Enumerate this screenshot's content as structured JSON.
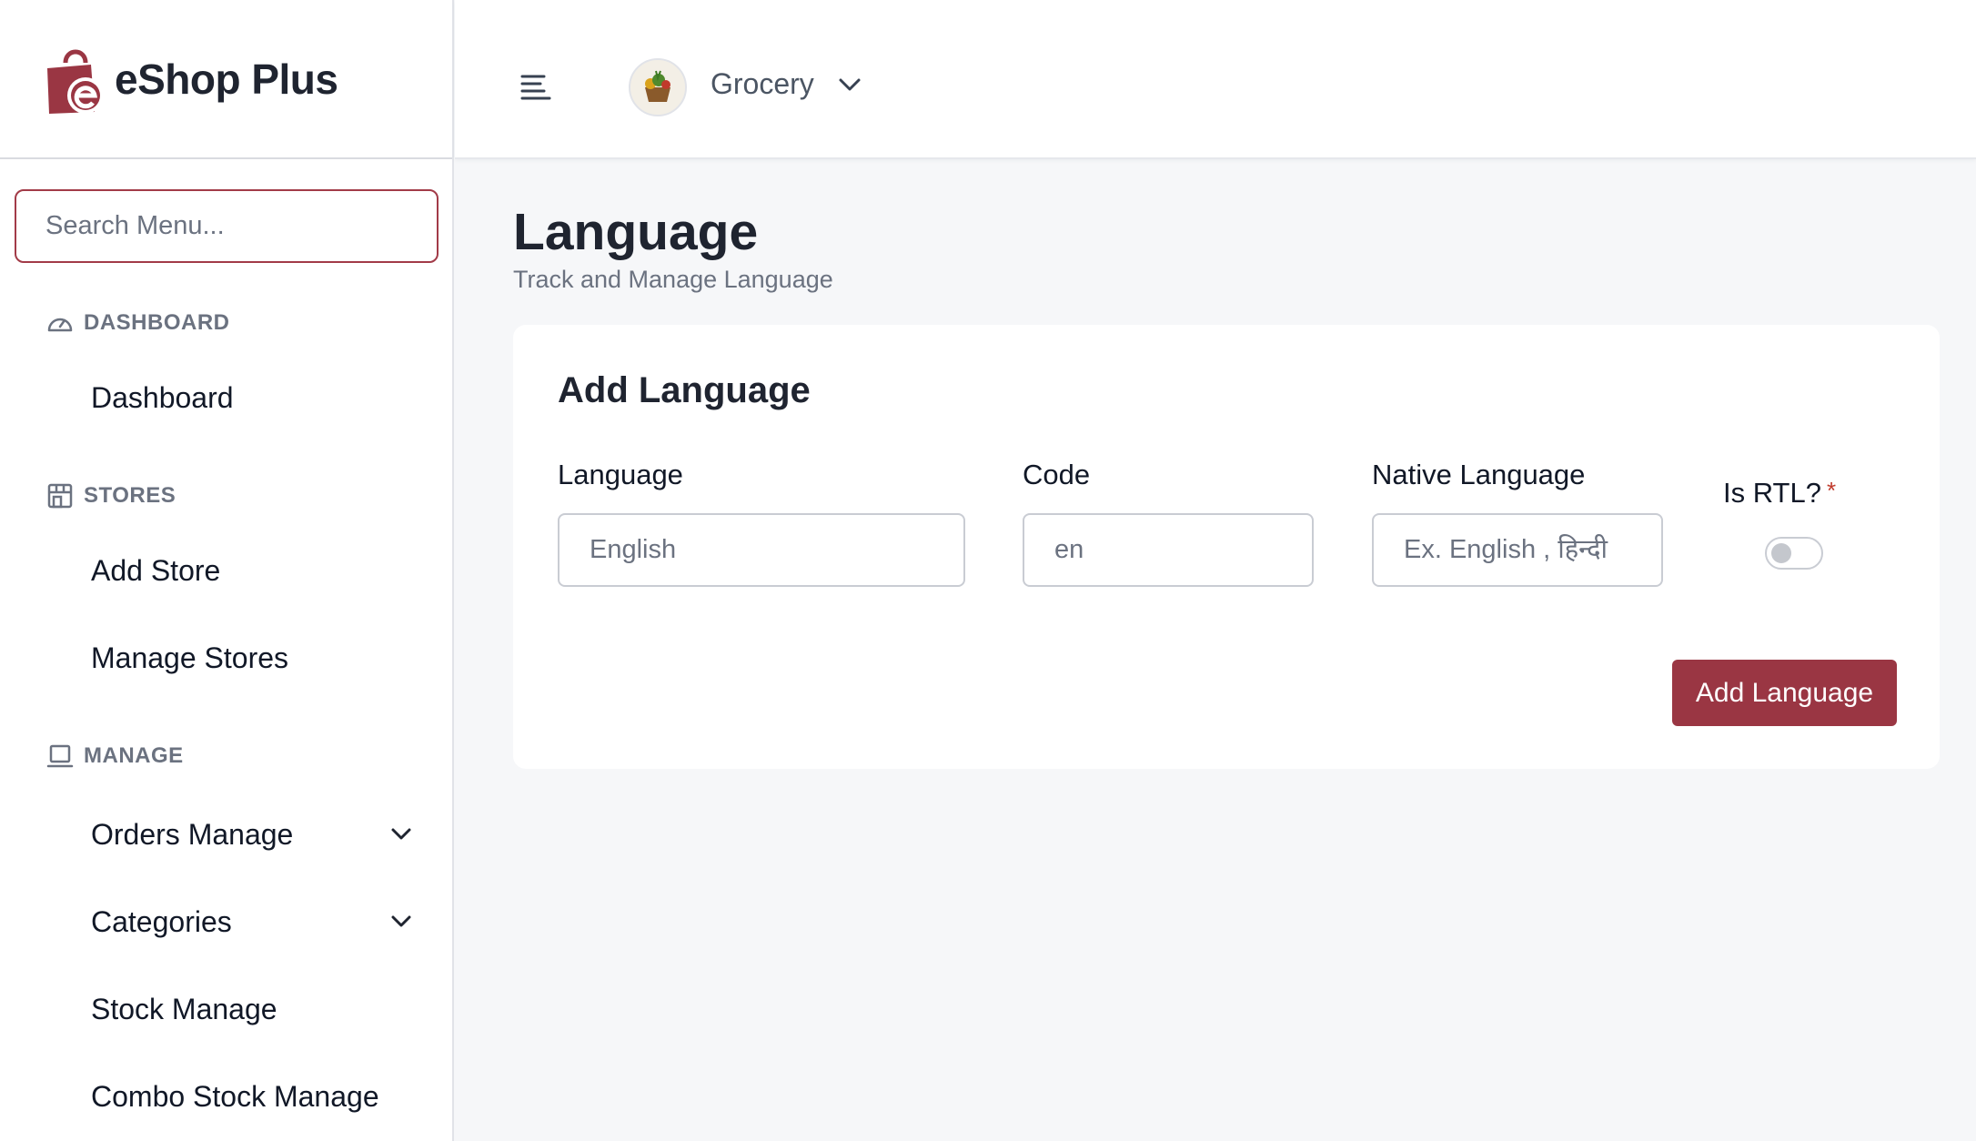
{
  "brand": {
    "name": "eShop Plus",
    "logo_color": "#9a3643"
  },
  "search": {
    "placeholder": "Search Menu..."
  },
  "sidebar": {
    "sections": [
      {
        "heading": "DASHBOARD",
        "icon": "speedometer-icon",
        "items": [
          {
            "label": "Dashboard",
            "expandable": false
          }
        ]
      },
      {
        "heading": "STORES",
        "icon": "storefront-icon",
        "items": [
          {
            "label": "Add Store",
            "expandable": false
          },
          {
            "label": "Manage Stores",
            "expandable": false
          }
        ]
      },
      {
        "heading": "MANAGE",
        "icon": "laptop-icon",
        "items": [
          {
            "label": "Orders Manage",
            "expandable": true
          },
          {
            "label": "Categories",
            "expandable": true
          },
          {
            "label": "Stock Manage",
            "expandable": false
          },
          {
            "label": "Combo Stock Manage",
            "expandable": false
          }
        ]
      }
    ]
  },
  "topbar": {
    "store_name": "Grocery",
    "menu_icon": "hamburger-icon"
  },
  "page": {
    "title": "Language",
    "subtitle": "Track and Manage Language"
  },
  "form": {
    "title": "Add Language",
    "language": {
      "label": "Language",
      "placeholder": "English"
    },
    "code": {
      "label": "Code",
      "placeholder": "en"
    },
    "native": {
      "label": "Native Language",
      "placeholder": "Ex. English , हिन्दी"
    },
    "rtl": {
      "label": "Is RTL?",
      "required_mark": "*",
      "value": false
    },
    "submit_label": "Add Language"
  },
  "colors": {
    "accent": "#9a3643",
    "background": "#f6f7f9"
  }
}
